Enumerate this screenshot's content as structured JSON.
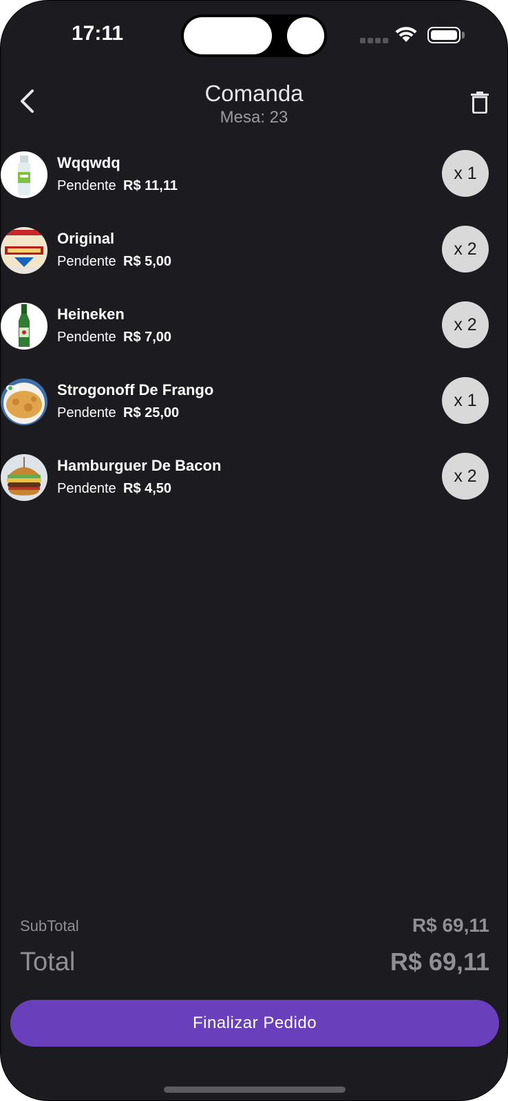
{
  "status_bar": {
    "time": "17:11"
  },
  "header": {
    "title": "Comanda",
    "subtitle": "Mesa: 23"
  },
  "items": [
    {
      "name": "Wqqwdq",
      "status": "Pendente",
      "price": "R$ 11,11",
      "qty": "x 1",
      "image": "bottled-drink-image"
    },
    {
      "name": "Original",
      "status": "Pendente",
      "price": "R$ 5,00",
      "qty": "x 2",
      "image": "beer-label-image"
    },
    {
      "name": "Heineken",
      "status": "Pendente",
      "price": "R$ 7,00",
      "qty": "x 2",
      "image": "green-beer-bottle-image"
    },
    {
      "name": "Strogonoff De Frango",
      "status": "Pendente",
      "price": "R$ 25,00",
      "qty": "x 1",
      "image": "strogonoff-dish-image"
    },
    {
      "name": "Hamburguer De Bacon",
      "status": "Pendente",
      "price": "R$ 4,50",
      "qty": "x 2",
      "image": "burger-image"
    }
  ],
  "totals": {
    "subtotal_label": "SubTotal",
    "subtotal_value": "R$ 69,11",
    "total_label": "Total",
    "total_value": "R$ 69,11"
  },
  "actions": {
    "finalize_label": "Finalizar Pedido"
  },
  "colors": {
    "background": "#1c1b20",
    "accent": "#6a3fbc",
    "quantity_badge": "#d9d9d9",
    "muted_text": "#8f8f95"
  },
  "icons": {
    "back": "chevron-left-icon",
    "delete": "trash-icon",
    "wifi": "wifi-icon",
    "battery": "battery-icon",
    "signal": "cellular-signal-icon"
  }
}
